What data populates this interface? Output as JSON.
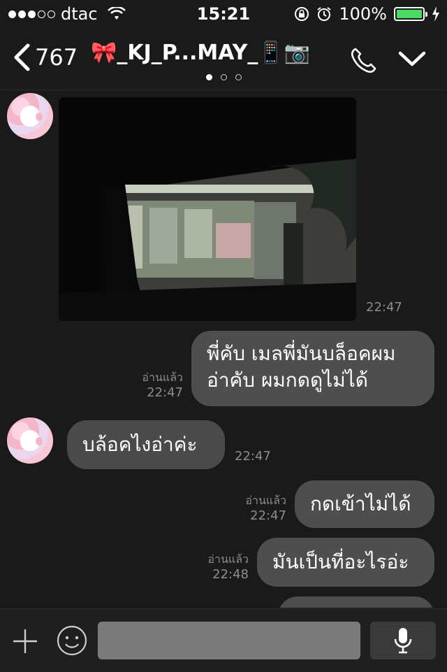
{
  "status": {
    "carrier": "dtac",
    "time": "15:21",
    "battery": "100%",
    "signal_bars": 3,
    "signal_total": 5
  },
  "header": {
    "back_count": "767",
    "title": "🎀_KJ_P...MAY_📱📷",
    "pages": 3,
    "active_page": 0
  },
  "messages": {
    "photo_time": "22:47",
    "out1": {
      "lines": [
        "พี่คับ เมลพี่มันบล็อคผม",
        "อ่าคับ ผมกดดูไม่ได้"
      ],
      "read": "อ่านแล้ว",
      "time": "22:47"
    },
    "in1": {
      "text": "บล้อคไงอ่าค่ะ",
      "time": "22:47"
    },
    "out2": {
      "text": "กดเข้าไม่ได้",
      "read": "อ่านแล้ว",
      "time": "22:47"
    },
    "out3": {
      "text": "มันเป็นที่อะไรอ่ะ",
      "read": "อ่านแล้ว",
      "time": "22:48"
    }
  },
  "composer": {
    "placeholder": ""
  },
  "colors": {
    "background": "#1a1a1a",
    "bubble": "#4a4a4a",
    "battery": "#4cd964",
    "meta": "#8d8d8d"
  },
  "icons": [
    "wifi-icon",
    "lock-rotation-icon",
    "alarm-icon",
    "battery-icon",
    "charging-icon",
    "back-chevron-icon",
    "phone-icon",
    "chevron-down-icon",
    "plus-icon",
    "emoji-icon",
    "microphone-icon"
  ]
}
